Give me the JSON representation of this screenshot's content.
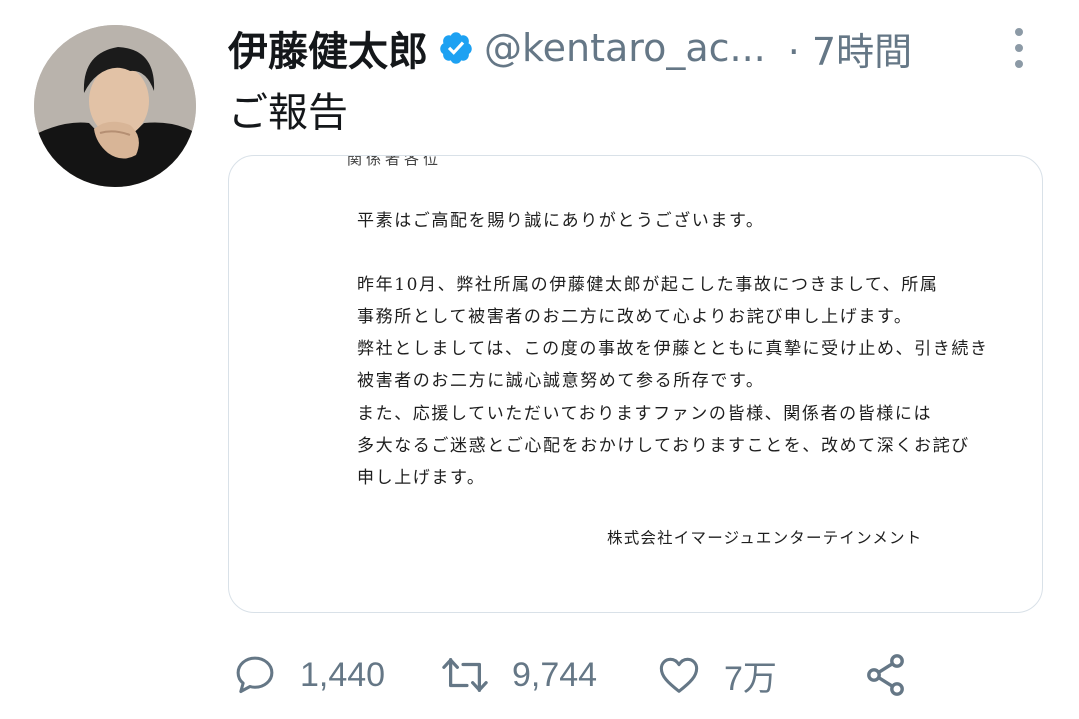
{
  "tweet": {
    "author_name": "伊藤健太郎",
    "author_handle": "@kentaro_ac...",
    "verified": true,
    "time": "· 7時間",
    "text": "ご報告"
  },
  "document": {
    "cut_line": "関係者各位",
    "lines": [
      "平素はご高配を賜り誠にありがとうございます。",
      "昨年10月、弊社所属の伊藤健太郎が起こした事故につきまして、所属",
      "事務所として被害者のお二方に改めて心よりお詫び申し上げます。",
      "弊社としましては、この度の事故を伊藤とともに真摯に受け止め、引き続き",
      "被害者のお二方に誠心誠意努めて参る所存です。",
      "また、応援していただいておりますファンの皆様、関係者の皆様には",
      "多大なるご迷惑とご心配をおかけしておりますことを、改めて深くお詫び",
      "申し上げます。"
    ],
    "signature": "株式会社イマージュエンターテインメント"
  },
  "actions": {
    "reply_icon": "reply-icon",
    "reply_count": "1,440",
    "retweet_icon": "retweet-icon",
    "retweet_count": "9,744",
    "like_icon": "heart-icon",
    "like_count": "7万",
    "share_icon": "share-icon"
  },
  "colors": {
    "verified_badge": "#1da1f2",
    "secondary_text": "#657786",
    "icon": "#657786",
    "border": "#d9e1e8"
  }
}
